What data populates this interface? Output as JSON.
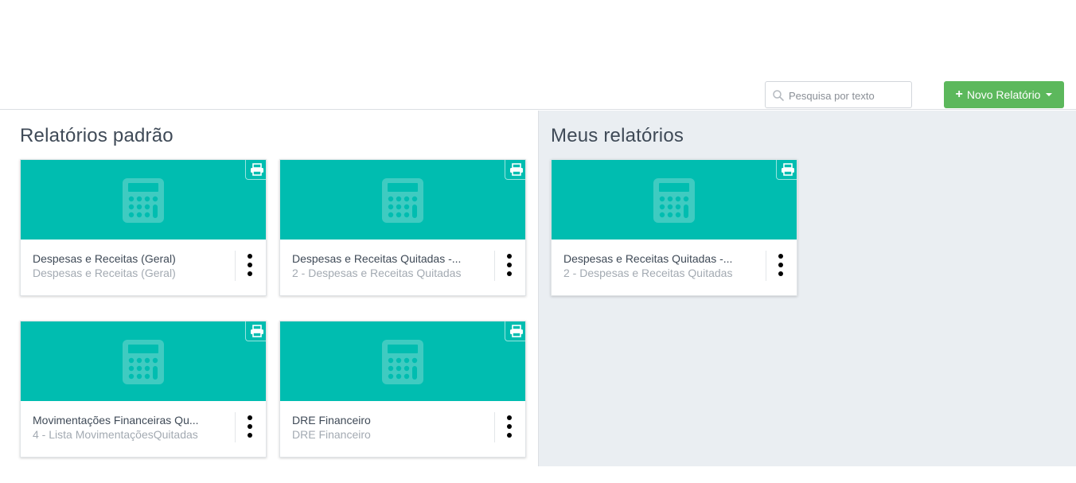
{
  "colors": {
    "teal": "#00bdb0",
    "green": "#5cb85c",
    "right_panel_bg": "#eaeef2"
  },
  "toolbar": {
    "search": {
      "placeholder": "Pesquisa por texto",
      "value": "",
      "icon": "search-icon"
    },
    "new_report_button": {
      "label": "Novo Relatório",
      "icon": "plus-icon"
    }
  },
  "default_reports": {
    "title": "Relatórios padrão",
    "cards": [
      {
        "title": "Despesas e Receitas (Geral)",
        "subtitle": "Despesas e Receitas (Geral)"
      },
      {
        "title": "Despesas e Receitas Quitadas -...",
        "subtitle": "2 - Despesas e Receitas Quitadas"
      },
      {
        "title": "Movimentações Financeiras Qu...",
        "subtitle": "4 - Lista MovimentaçõesQuitadas"
      },
      {
        "title": "DRE Financeiro",
        "subtitle": "DRE Financeiro"
      }
    ]
  },
  "my_reports": {
    "title": "Meus relatórios",
    "cards": [
      {
        "title": "Despesas e Receitas Quitadas -...",
        "subtitle": "2 - Despesas e Receitas Quitadas"
      }
    ]
  }
}
